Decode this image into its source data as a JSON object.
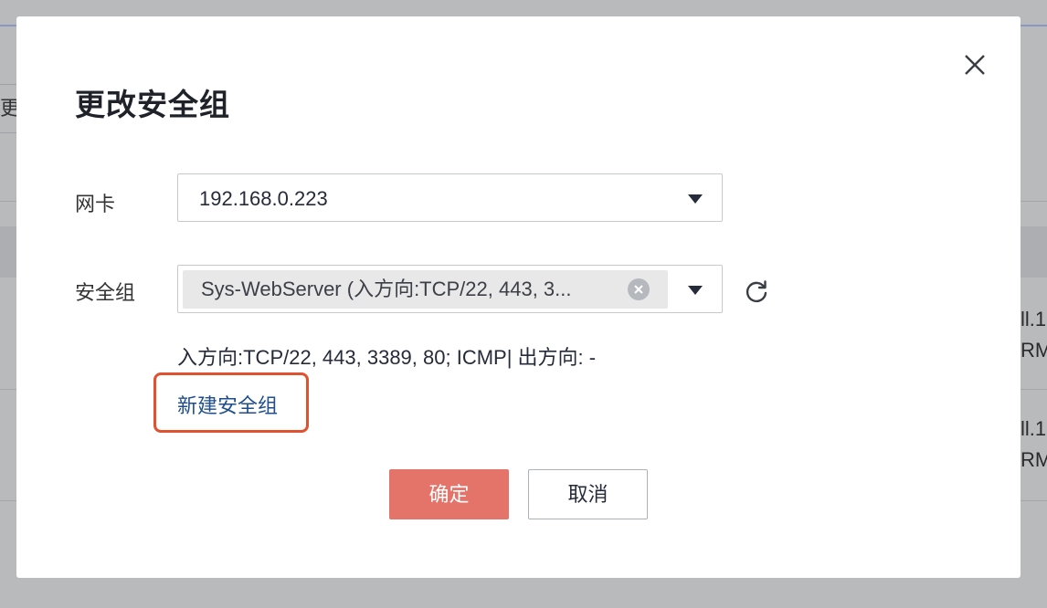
{
  "background": {
    "left_cell_text": "更",
    "right_rows": [
      {
        "line1": "ll.1",
        "line2": "RM"
      },
      {
        "line1": "ll.1",
        "line2": "RM"
      }
    ]
  },
  "dialog": {
    "title": "更改安全组",
    "close_icon": "close-icon",
    "nic": {
      "label": "网卡",
      "value": "192.168.0.223"
    },
    "security_group": {
      "label": "安全组",
      "selected_tag": "Sys-WebServer (入方向:TCP/22, 443, 3...",
      "clear_icon": "clear-icon",
      "refresh_icon": "refresh-icon"
    },
    "rule_summary": "入方向:TCP/22, 443, 3389, 80; ICMP| 出方向: -",
    "create_link": "新建安全组",
    "buttons": {
      "confirm": "确定",
      "cancel": "取消"
    }
  },
  "colors": {
    "primary": "#e4736a",
    "link": "#1e4e8c",
    "highlight": "#e0512f"
  }
}
